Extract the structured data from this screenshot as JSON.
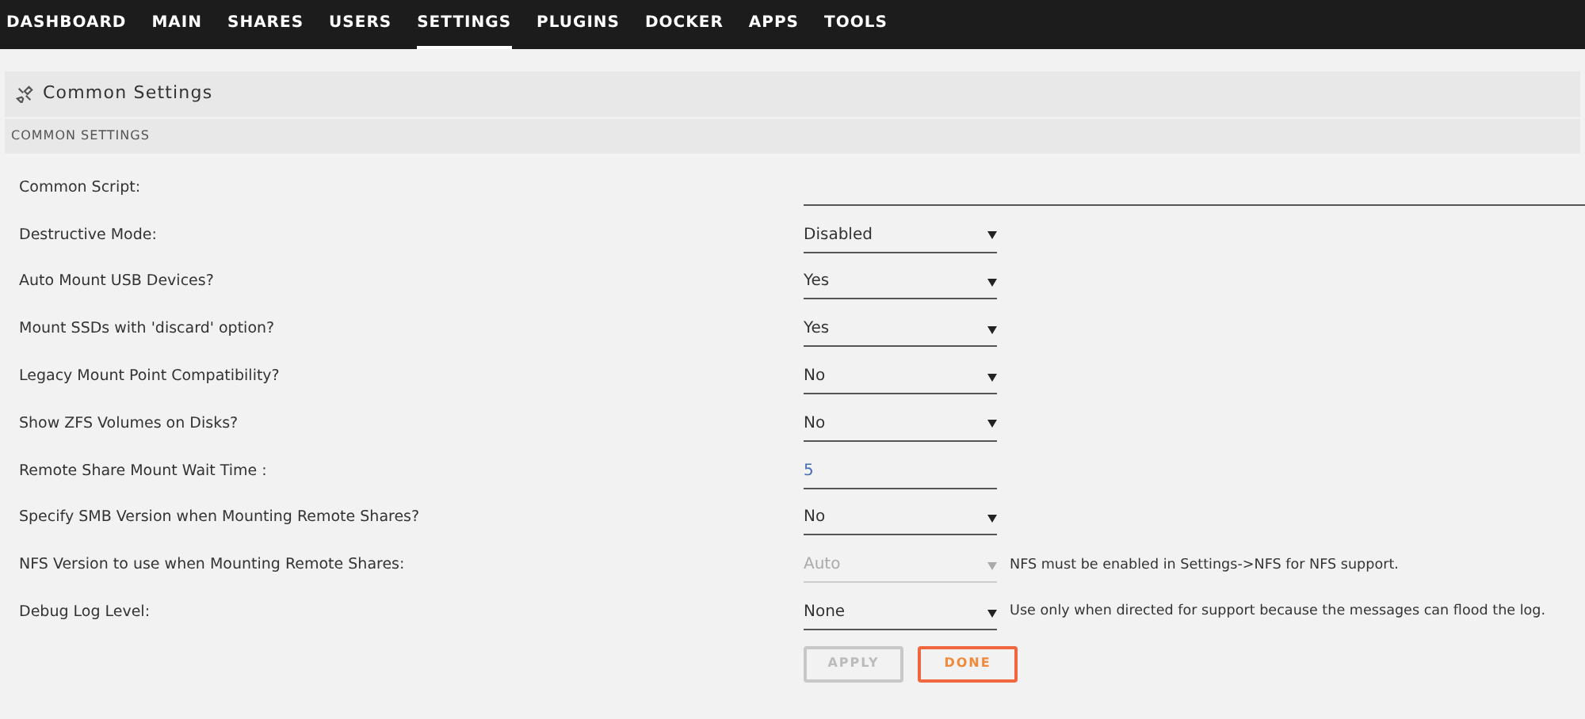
{
  "nav": [
    {
      "label": "DASHBOARD",
      "selected": false
    },
    {
      "label": "MAIN",
      "selected": false
    },
    {
      "label": "SHARES",
      "selected": false
    },
    {
      "label": "USERS",
      "selected": false
    },
    {
      "label": "SETTINGS",
      "selected": true
    },
    {
      "label": "PLUGINS",
      "selected": false
    },
    {
      "label": "DOCKER",
      "selected": false
    },
    {
      "label": "APPS",
      "selected": false
    },
    {
      "label": "TOOLS",
      "selected": false
    }
  ],
  "panel": {
    "title": "Common Settings",
    "section": "COMMON SETTINGS"
  },
  "settings": [
    {
      "label": "Common Script:",
      "kind": "text"
    },
    {
      "label": "Destructive Mode:",
      "kind": "select",
      "value": "Disabled",
      "disabled": false
    },
    {
      "label": "Auto Mount USB Devices?",
      "kind": "select",
      "value": "Yes",
      "disabled": false
    },
    {
      "label": "Mount SSDs with 'discard' option?",
      "kind": "select",
      "value": "Yes",
      "disabled": false
    },
    {
      "label": "Legacy Mount Point Compatibility?",
      "kind": "select",
      "value": "No",
      "disabled": false
    },
    {
      "label": "Show ZFS Volumes on Disks?",
      "kind": "select",
      "value": "No",
      "disabled": false
    },
    {
      "label": "Remote Share Mount Wait Time :",
      "kind": "number",
      "value": "5"
    },
    {
      "label": "Specify SMB Version when Mounting Remote Shares?",
      "kind": "select",
      "value": "No",
      "disabled": false
    },
    {
      "label": "NFS Version to use when Mounting Remote Shares:",
      "kind": "select",
      "value": "Auto",
      "disabled": true,
      "help": "NFS must be enabled in Settings->NFS for NFS support."
    },
    {
      "label": "Debug Log Level:",
      "kind": "select",
      "value": "None",
      "disabled": false,
      "help": "Use only when directed for support because the messages can flood the log."
    }
  ],
  "buttons": [
    {
      "label": "APPLY",
      "disabled": true
    },
    {
      "label": "DONE",
      "disabled": false
    }
  ]
}
